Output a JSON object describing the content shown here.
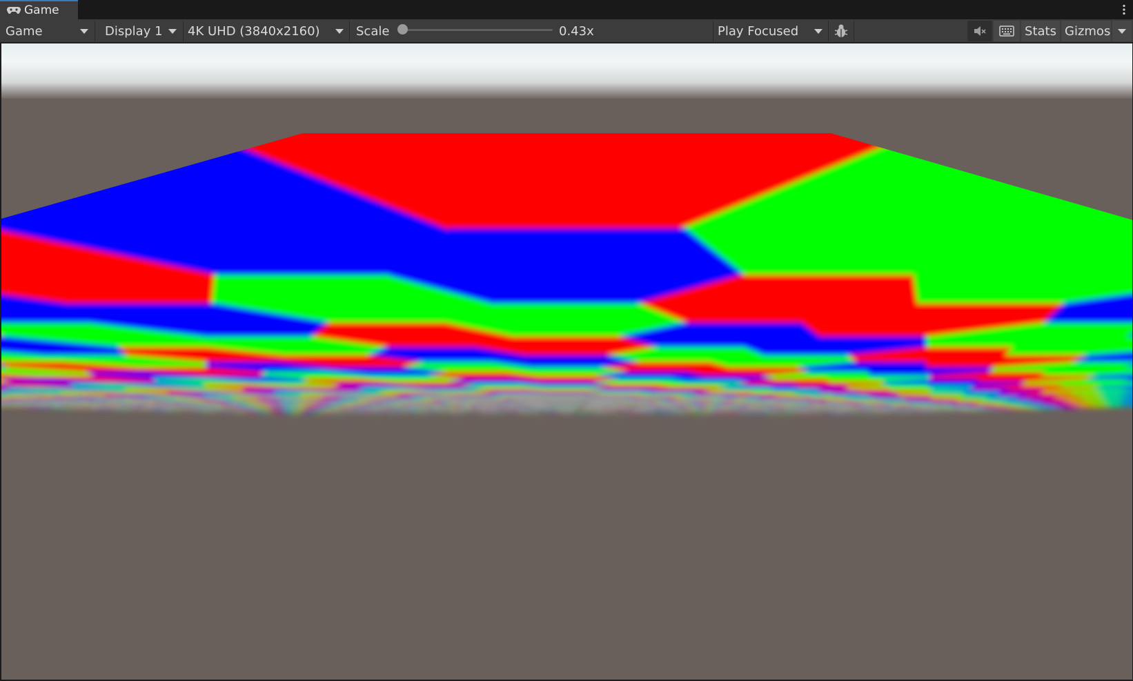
{
  "tab": {
    "label": "Game",
    "icon": "gamepad-icon"
  },
  "toolbar": {
    "view_mode": "Game",
    "display": "Display 1",
    "resolution": "4K UHD (3840x2160)",
    "scale_label": "Scale",
    "scale_value": "0.43x",
    "play_mode": "Play Focused",
    "stats_label": "Stats",
    "gizmos_label": "Gizmos"
  },
  "scene": {
    "sky_color": "#eef2f3",
    "ground_color": "#6a605b",
    "tile_colors": [
      "#ff0000",
      "#00ff00",
      "#0000ff"
    ]
  }
}
